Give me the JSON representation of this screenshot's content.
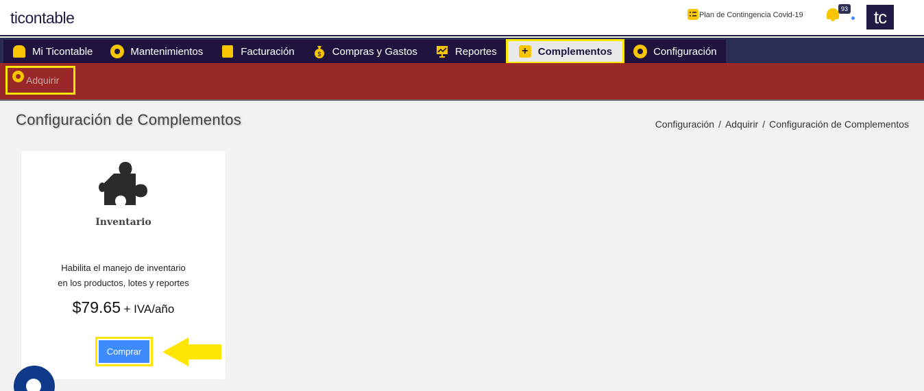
{
  "header": {
    "logo": "ticontable",
    "covid_link": "Plan de Contingencia Covid-19",
    "notification_count": "93",
    "avatar_initials": "tc"
  },
  "nav": {
    "items": [
      {
        "label": "Mi Ticontable",
        "icon": "home-icon"
      },
      {
        "label": "Mantenimientos",
        "icon": "gear-icon"
      },
      {
        "label": "Facturación",
        "icon": "invoice-icon"
      },
      {
        "label": "Compras y Gastos",
        "icon": "money-bag-icon"
      },
      {
        "label": "Reportes",
        "icon": "chart-icon"
      },
      {
        "label": "Complementos",
        "icon": "plus-icon",
        "active": true
      },
      {
        "label": "Configuración",
        "icon": "gear-icon"
      }
    ]
  },
  "subnav": {
    "items": [
      {
        "label": "Adquirir",
        "icon": "gear-icon"
      }
    ]
  },
  "page": {
    "title": "Configuración de Complementos",
    "breadcrumb": [
      "Configuración",
      "Adquirir",
      "Configuración de Complementos"
    ],
    "breadcrumb_sep": "/"
  },
  "addon": {
    "name": "Inventario",
    "description_line1": "Habilita el manejo de inventario",
    "description_line2": "en los productos, lotes y reportes",
    "price": "$79.65",
    "price_suffix": "+ IVA/año",
    "buy_label": "Comprar",
    "icon": "puzzle-icon"
  },
  "colors": {
    "nav_bg": "#20143f",
    "subbar_bg": "#9b2828",
    "accent_yellow": "#f7c600",
    "highlight": "#ffe600",
    "button_blue": "#3d8bfd"
  }
}
